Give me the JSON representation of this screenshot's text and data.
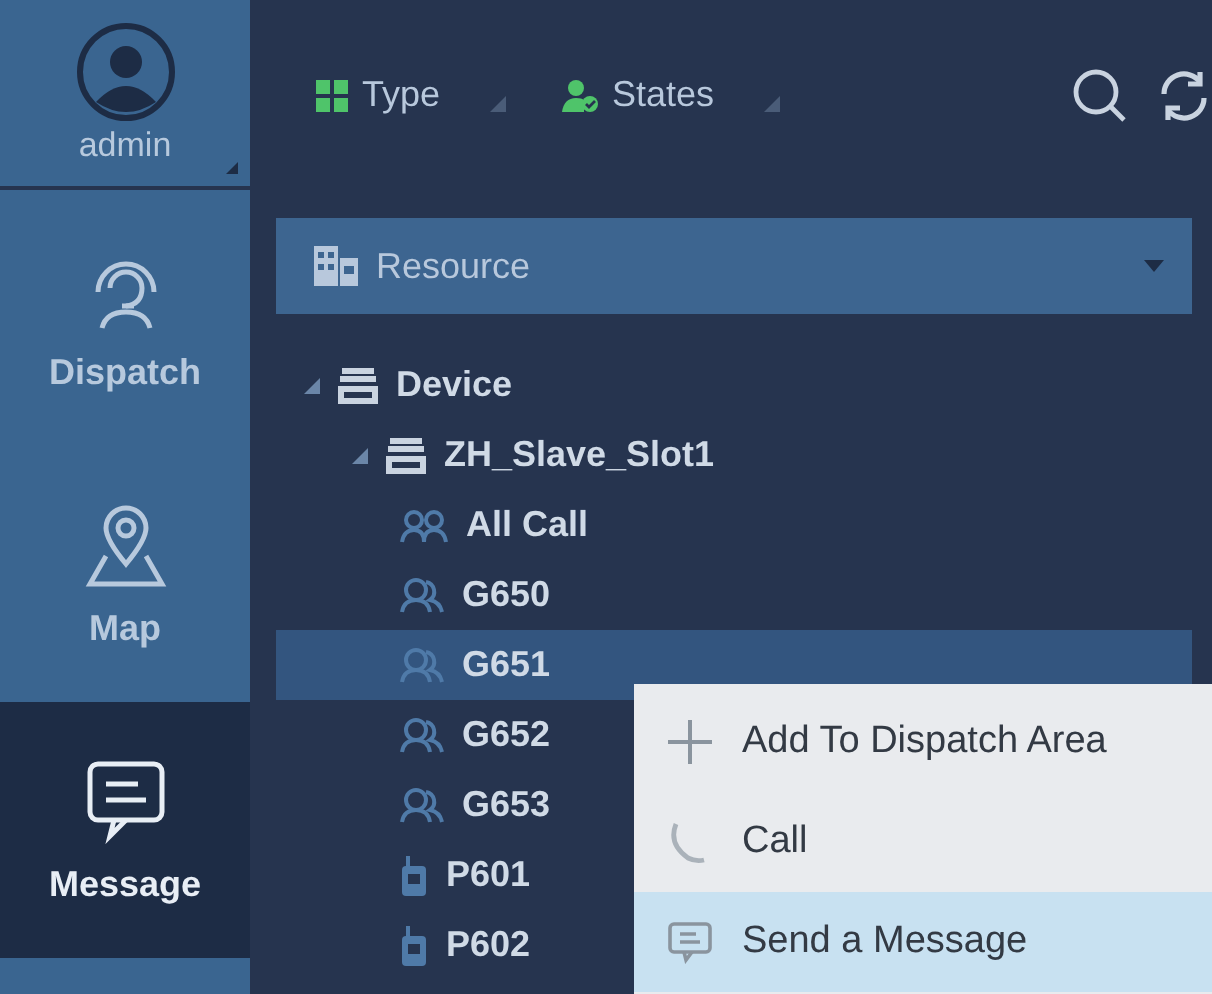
{
  "user": {
    "name": "admin"
  },
  "nav": [
    {
      "label": "Dispatch",
      "selected": false
    },
    {
      "label": "Map",
      "selected": false
    },
    {
      "label": "Message",
      "selected": true
    }
  ],
  "toolbar": {
    "filters": [
      {
        "label": "Type"
      },
      {
        "label": "States"
      }
    ]
  },
  "resource": {
    "label": "Resource"
  },
  "tree": [
    {
      "label": "Device",
      "kind": "device",
      "expanded": true,
      "selected": false,
      "children": [
        {
          "label": "ZH_Slave_Slot1",
          "kind": "device",
          "expanded": true,
          "selected": false,
          "children": [
            {
              "label": "All Call",
              "kind": "broadcast",
              "selected": false
            },
            {
              "label": "G650",
              "kind": "group",
              "selected": false
            },
            {
              "label": "G651",
              "kind": "group",
              "selected": true
            },
            {
              "label": "G652",
              "kind": "group",
              "selected": false
            },
            {
              "label": "G653",
              "kind": "group",
              "selected": false
            },
            {
              "label": "P601",
              "kind": "radio",
              "selected": false
            },
            {
              "label": "P602",
              "kind": "radio",
              "selected": false
            }
          ]
        }
      ]
    }
  ],
  "context_menu": [
    {
      "label": "Add To Dispatch Area",
      "kind": "add",
      "selected": false
    },
    {
      "label": "Call",
      "kind": "call",
      "selected": false
    },
    {
      "label": "Send a Message",
      "kind": "message",
      "selected": true
    }
  ]
}
